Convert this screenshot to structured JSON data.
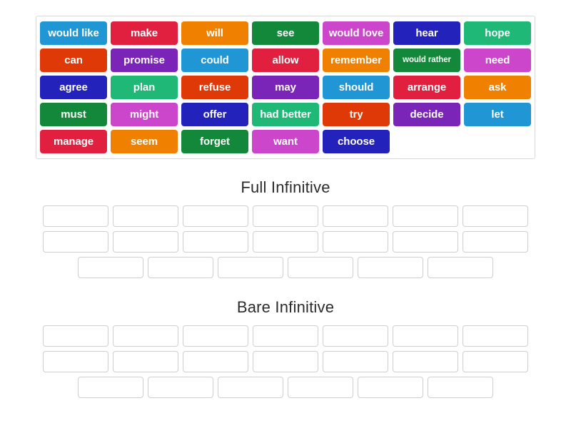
{
  "word_bank": {
    "rows": [
      [
        {
          "label": "would like",
          "color": "#2196d4"
        },
        {
          "label": "make",
          "color": "#e0203e"
        },
        {
          "label": "will",
          "color": "#f08000"
        },
        {
          "label": "see",
          "color": "#13883a"
        },
        {
          "label": "would love",
          "color": "#cc46cc"
        },
        {
          "label": "hear",
          "color": "#2323bb"
        },
        {
          "label": "hope",
          "color": "#1fb877"
        }
      ],
      [
        {
          "label": "can",
          "color": "#df3908"
        },
        {
          "label": "promise",
          "color": "#7b24b8"
        },
        {
          "label": "could",
          "color": "#2196d4"
        },
        {
          "label": "allow",
          "color": "#e0203e"
        },
        {
          "label": "remember",
          "color": "#f08000"
        },
        {
          "label": "would rather",
          "color": "#13883a",
          "small": true
        },
        {
          "label": "need",
          "color": "#cc46cc"
        }
      ],
      [
        {
          "label": "agree",
          "color": "#2323bb"
        },
        {
          "label": "plan",
          "color": "#1fb877"
        },
        {
          "label": "refuse",
          "color": "#df3908"
        },
        {
          "label": "may",
          "color": "#7b24b8"
        },
        {
          "label": "should",
          "color": "#2196d4"
        },
        {
          "label": "arrange",
          "color": "#e0203e"
        },
        {
          "label": "ask",
          "color": "#f08000"
        }
      ],
      [
        {
          "label": "must",
          "color": "#13883a"
        },
        {
          "label": "might",
          "color": "#cc46cc"
        },
        {
          "label": "offer",
          "color": "#2323bb"
        },
        {
          "label": "had better",
          "color": "#1fb877"
        },
        {
          "label": "try",
          "color": "#df3908"
        },
        {
          "label": "decide",
          "color": "#7b24b8"
        },
        {
          "label": "let",
          "color": "#2196d4"
        }
      ],
      [
        {
          "label": "manage",
          "color": "#e0203e"
        },
        {
          "label": "seem",
          "color": "#f08000"
        },
        {
          "label": "forget",
          "color": "#13883a"
        },
        {
          "label": "want",
          "color": "#cc46cc"
        },
        {
          "label": "choose",
          "color": "#2323bb"
        }
      ]
    ]
  },
  "groups": [
    {
      "title": "Full Infinitive",
      "slot_rows": [
        7,
        7,
        6
      ]
    },
    {
      "title": "Bare Infinitive",
      "slot_rows": [
        7,
        7,
        6
      ]
    }
  ]
}
